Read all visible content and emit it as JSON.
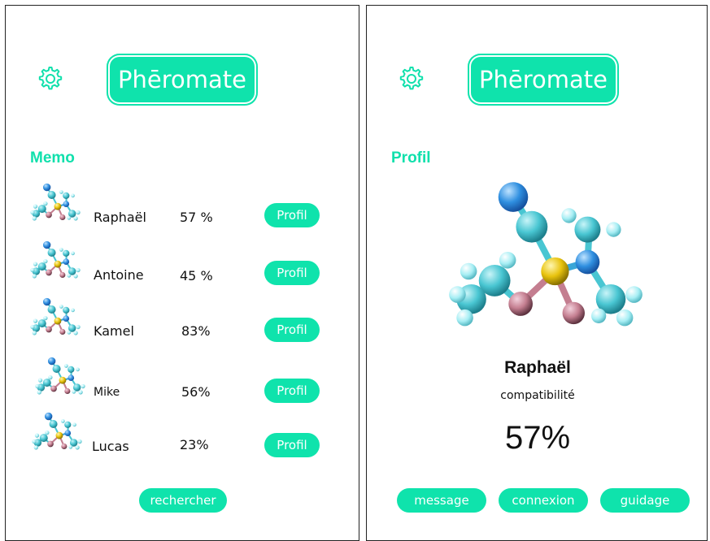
{
  "app": {
    "logo_text": "Phēromate"
  },
  "memo_screen": {
    "section_title": "Memo",
    "profile_button_label": "Profil",
    "entries": [
      {
        "name": "Raphaël",
        "percent": "57 %"
      },
      {
        "name": "Antoine",
        "percent": "45 %"
      },
      {
        "name": "Kamel",
        "percent": "83%"
      },
      {
        "name": "Mike",
        "percent": "56%"
      },
      {
        "name": "Lucas",
        "percent": "23%"
      }
    ],
    "search_button_label": "rechercher"
  },
  "profile_screen": {
    "section_title": "Profil",
    "name": "Raphaël",
    "compat_label": "compatibilité",
    "compat_value": "57%",
    "buttons": {
      "message": "message",
      "connexion": "connexion",
      "guidage": "guidage"
    }
  },
  "colors": {
    "accent": "#0fe3ac",
    "molecule_cyan": "#49c6d2",
    "molecule_blue": "#2f8fe0",
    "molecule_yellow": "#e8c30e",
    "molecule_pink": "#c47e90"
  },
  "icons": {
    "settings": "gear-icon",
    "molecule": "molecule-image"
  }
}
